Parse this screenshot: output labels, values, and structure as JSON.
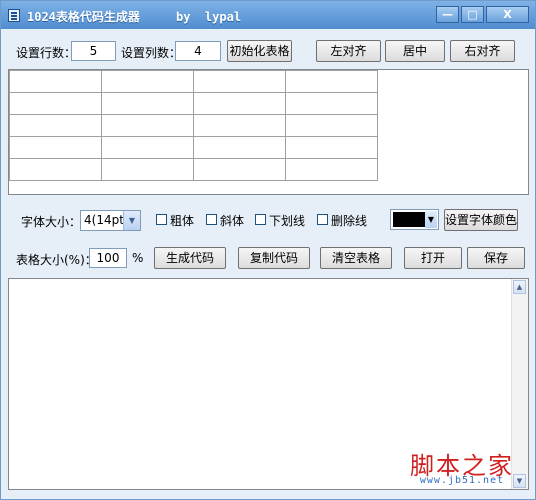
{
  "window": {
    "title": "1024表格代码生成器",
    "author": "by  lypal",
    "min_label": "—",
    "max_label": "□",
    "close_label": "X"
  },
  "controls": {
    "rows_label": "设置行数：",
    "rows_value": "5",
    "cols_label": "设置列数：",
    "cols_value": "4",
    "init_button": "初始化表格",
    "align_left": "左对齐",
    "align_center": "居中",
    "align_right": "右对齐"
  },
  "preview_table": {
    "rows": 5,
    "cols": 4
  },
  "font": {
    "size_label": "字体大小：",
    "size_value": "4(14pt)",
    "bold": "粗体",
    "italic": "斜体",
    "underline": "下划线",
    "strike": "删除线",
    "color_value": "#000000",
    "color_button": "设置字体颜色"
  },
  "table_size": {
    "label": "表格大小(%)：",
    "value": "100",
    "unit": "%",
    "generate": "生成代码",
    "copy": "复制代码",
    "clear": "清空表格",
    "open": "打开",
    "save": "保存"
  },
  "output": {
    "watermark": "脚本之家",
    "watermark_url": "www.jb51.net"
  }
}
